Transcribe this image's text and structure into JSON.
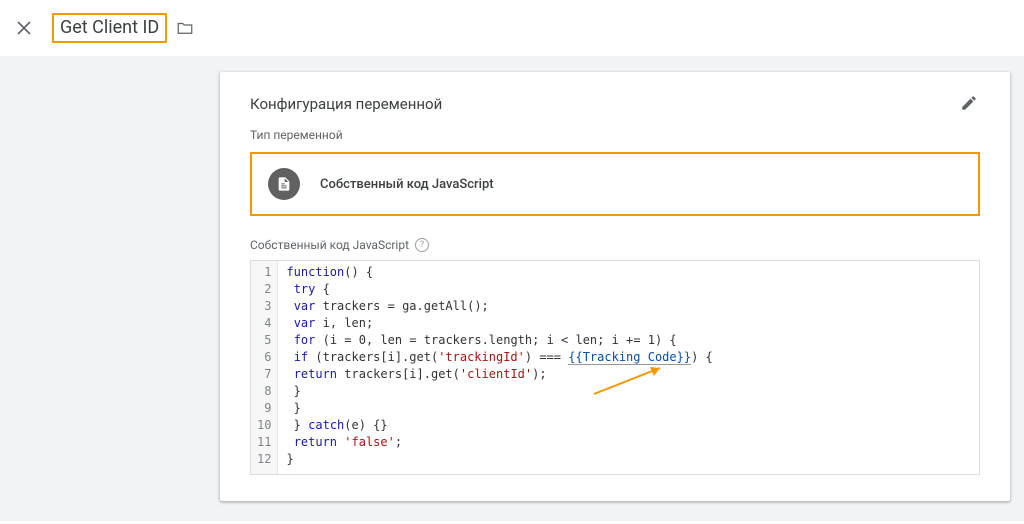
{
  "header": {
    "title": "Get Client ID"
  },
  "panel": {
    "title": "Конфигурация переменной",
    "type_label": "Тип переменной",
    "type_name": "Собственный код JavaScript",
    "code_label": "Собственный код JavaScript"
  },
  "code": {
    "lines": 12,
    "l1_a": "function",
    "l1_b": "() {",
    "l2_a": " ",
    "l2_b": "try",
    "l2_c": " {",
    "l3_a": " ",
    "l3_b": "var",
    "l3_c": " trackers = ga.getAll();",
    "l4_a": " ",
    "l4_b": "var",
    "l4_c": " i, len;",
    "l5_a": " ",
    "l5_b": "for",
    "l5_c": " (i = ",
    "l5_d": "0",
    "l5_e": ", len = trackers.length; i < len; i += ",
    "l5_f": "1",
    "l5_g": ") {",
    "l6_a": " ",
    "l6_b": "if",
    "l6_c": " (trackers[i].get(",
    "l6_d": "'trackingId'",
    "l6_e": ") === ",
    "l6_f": "{{Tracking Code}}",
    "l6_g": ") {",
    "l7_a": " ",
    "l7_b": "return",
    "l7_c": " trackers[i].get(",
    "l7_d": "'clientId'",
    "l7_e": ");",
    "l8": " }",
    "l9": " }",
    "l10_a": " } ",
    "l10_b": "catch",
    "l10_c": "(e) {}",
    "l11_a": " ",
    "l11_b": "return",
    "l11_c": " ",
    "l11_d": "'false'",
    "l11_e": ";",
    "l12": "}"
  }
}
